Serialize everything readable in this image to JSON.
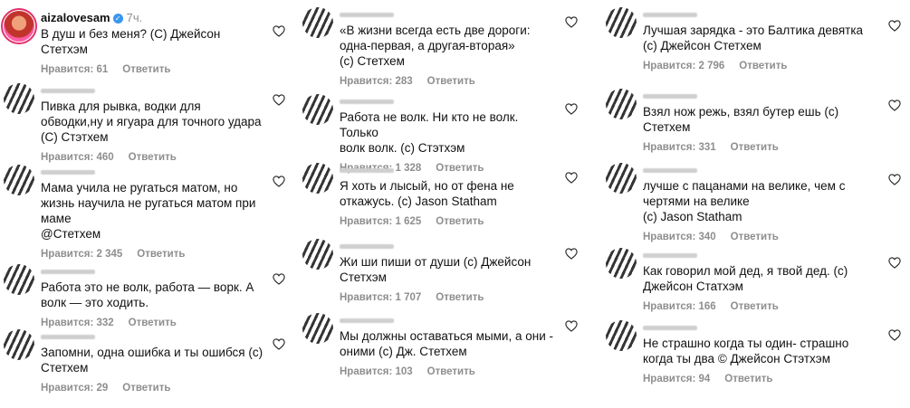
{
  "heart_icon": "heart-outline-icon",
  "colors": {
    "text": "#111111",
    "muted": "#8e8e8e",
    "verified": "#3897f0"
  },
  "columns": [
    {
      "comments": [
        {
          "username": "aizalovesam",
          "verified": true,
          "time": "7ч.",
          "text": "В душ и без меня? (С) Джейсон\nСтетхэм",
          "likes": "Нравится: 61",
          "reply": "Ответить"
        },
        {
          "username": "",
          "text": "Пивка для рывка, водки для\nобводки,ну и ягуара для точного удара\n(С) Стэтхем",
          "likes": "Нравится: 460",
          "reply": "Ответить"
        },
        {
          "username": "",
          "text": "Мама учила не ругаться матом, но\nжизнь научила не ругаться матом при\nмаме\n@Стетхем",
          "likes": "Нравится: 2 345",
          "reply": "Ответить"
        },
        {
          "username": "",
          "text": "Работа это не волк, работа — ворк. А\nволк — это ходить.",
          "likes": "Нравится: 332",
          "reply": "Ответить"
        },
        {
          "username": "",
          "text": "Запомни, одна ошибка и ты ошибся (с)\nСтетхем",
          "likes": "Нравится: 29",
          "reply": "Ответить"
        }
      ]
    },
    {
      "comments": [
        {
          "username": "",
          "text": "«В жизни всегда есть две дороги:\nодна-первая, а другая-вторая»\n(с) Стетхем",
          "likes": "Нравится: 283",
          "reply": "Ответить"
        },
        {
          "username": "",
          "text": "Работа не волк. Ни кто не волк. Только\nволк волк. (с) Стэтхэм",
          "likes": "Нравится: 1 328",
          "reply": "Ответить"
        },
        {
          "username": "",
          "text": "Я хоть и лысый, но от фена не\nоткажусь. (с) Jason Statham",
          "likes": "Нравится: 1 625",
          "reply": "Ответить"
        },
        {
          "username": "",
          "text": "Жи ши пиши от души (с) Джейсон\nСтетхэм",
          "likes": "Нравится: 1 707",
          "reply": "Ответить"
        },
        {
          "username": "",
          "text": "Мы должны оставаться мыми, а они -\nоними (с) Дж. Стетхем",
          "likes": "Нравится: 103",
          "reply": "Ответить"
        }
      ]
    },
    {
      "comments": [
        {
          "username": "",
          "text": "Лучшая зарядка - это Балтика девятка\n(с) Джейсон Стетхем",
          "likes": "Нравится: 2 796",
          "reply": "Ответить"
        },
        {
          "username": "",
          "text": "Взял нож режь, взял бутер ешь (с)\nСтетхем",
          "likes": "Нравится: 331",
          "reply": "Ответить"
        },
        {
          "username": "",
          "text": "лучше с пацанами на велике, чем с\nчертями на велике\n(с) Jason Statham",
          "likes": "Нравится: 340",
          "reply": "Ответить"
        },
        {
          "username": "",
          "text": "Как говорил мой дед, я твой дед. (с)\nДжейсон Статхэм",
          "likes": "Нравится: 166",
          "reply": "Ответить"
        },
        {
          "username": "",
          "text": "Не страшно когда ты один- страшно\nкогда ты два © Джейсон Стэтхэм",
          "likes": "Нравится: 94",
          "reply": "Ответить"
        }
      ]
    }
  ]
}
